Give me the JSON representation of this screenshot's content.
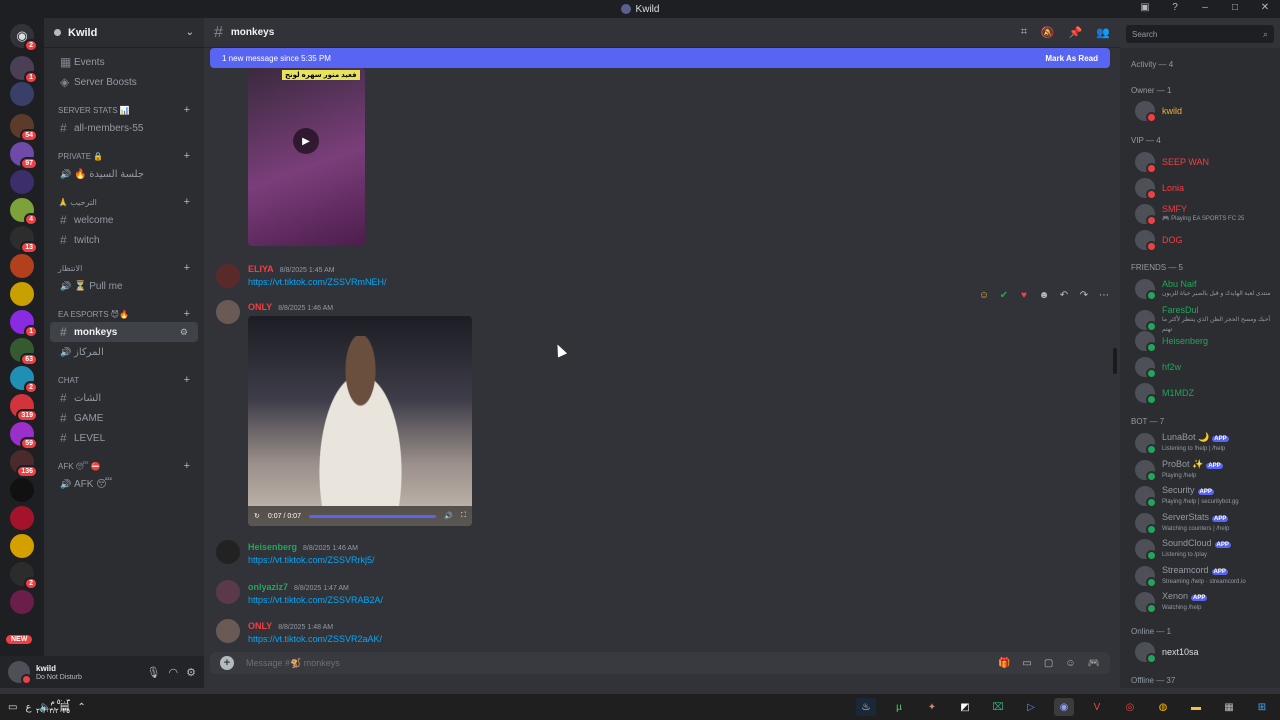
{
  "window": {
    "title": "Kwild"
  },
  "rail": {
    "servers": [
      {
        "badge": "2",
        "color": "#313338"
      },
      {
        "badge": "1",
        "color": "#4a3f55"
      },
      {
        "badge": "",
        "color": "#3a3f6a"
      },
      {
        "badge": "54",
        "color": "#5d3b2a"
      },
      {
        "badge": "97",
        "color": "#6f4aa8"
      },
      {
        "badge": "",
        "color": "#3b2e6a"
      },
      {
        "badge": "4",
        "color": "#7ca33a"
      },
      {
        "badge": "13",
        "color": "#2d2d2d"
      },
      {
        "badge": "",
        "color": "#b3401c"
      },
      {
        "badge": "",
        "color": "#c8a000"
      },
      {
        "badge": "1",
        "color": "#8a2be2"
      },
      {
        "badge": "63",
        "color": "#365a2f"
      },
      {
        "badge": "2",
        "color": "#1f8fb3"
      },
      {
        "badge": "319",
        "color": "#d1343c"
      },
      {
        "badge": "59",
        "color": "#9a2fc9"
      },
      {
        "badge": "136",
        "color": "#4a2a2a"
      },
      {
        "badge": "",
        "color": "#111111"
      },
      {
        "badge": "",
        "color": "#a3142a"
      },
      {
        "badge": "",
        "color": "#d4a000"
      },
      {
        "badge": "2",
        "color": "#2c2c2c"
      },
      {
        "badge": "",
        "color": "#6a1e4a"
      }
    ],
    "new_label": "NEW"
  },
  "sidebar": {
    "server_name": "Kwild",
    "top_items": [
      "Events",
      "Server Boosts"
    ],
    "categories": [
      {
        "name": "SERVER STATS 📊",
        "channels": [
          {
            "name": "all-members-55",
            "type": "text"
          }
        ]
      },
      {
        "name": "Private 🔒",
        "channels": [
          {
            "name": "🔥 جلسة السيدة",
            "type": "voice"
          }
        ]
      },
      {
        "name": "🙏 الترحيب",
        "channels": [
          {
            "name": "welcome",
            "type": "text"
          },
          {
            "name": "twitch",
            "type": "text"
          }
        ]
      },
      {
        "name": "الانتظار",
        "channels": [
          {
            "name": "⏳ Pull me",
            "type": "voice"
          }
        ]
      },
      {
        "name": "EA ESPORTS 😈🔥",
        "channels": [
          {
            "name": "monkeys",
            "type": "text",
            "active": true
          },
          {
            "name": "المركاز",
            "type": "voice"
          }
        ]
      },
      {
        "name": "CHAT",
        "channels": [
          {
            "name": "الشات",
            "type": "text"
          },
          {
            "name": "GAME",
            "type": "text"
          },
          {
            "name": "LEVEL",
            "type": "text"
          }
        ]
      },
      {
        "name": "AFK 😴 ⛔",
        "channels": [
          {
            "name": "AFK 😴",
            "type": "voice"
          }
        ]
      }
    ]
  },
  "user": {
    "name": "kwild",
    "status": "Do Not Disturb"
  },
  "channel": {
    "name": "monkeys"
  },
  "search": {
    "placeholder": "Search"
  },
  "newbar": {
    "text": "1 new message since 5:35 PM",
    "mark_label": "Mark As Read"
  },
  "messages": [
    {
      "name": "ELIYA",
      "name_color": "#f23f43",
      "time": "8/8/2025 1:45 AM",
      "link": "https://vt.tiktok.com/ZSSVRmNEH/"
    },
    {
      "name": "ONLY",
      "name_color": "#f23f43",
      "time": "8/8/2025 1:46 AM",
      "video_time": "0:07 / 0:07"
    },
    {
      "name": "Heisenberg",
      "name_color": "#23a55a",
      "time": "8/8/2025 1:46 AM",
      "link": "https://vt.tiktok.com/ZSSVRrkj5/"
    },
    {
      "name": "onlyaziz7",
      "name_color": "#23a55a",
      "time": "8/8/2025 1:47 AM",
      "link": "https://vt.tiktok.com/ZSSVRAB2A/"
    },
    {
      "name": "ONLY",
      "name_color": "#f23f43",
      "time": "8/8/2025 1:48 AM",
      "link": "https://vt.tiktok.com/ZSSVR2aAK/"
    }
  ],
  "video1_caption": "فعيد منور سهره لونج",
  "composer": {
    "placeholder": "Message #🐒 monkeys"
  },
  "members": {
    "activity": "Activity — 4",
    "owner_header": "Owner — 1",
    "owner": [
      {
        "name": "kwild",
        "color": "#f0b232",
        "sub": ""
      }
    ],
    "vip_header": "VIP — 4",
    "vip": [
      {
        "name": "SEEP WAN",
        "color": "#f23f43",
        "sub": ""
      },
      {
        "name": "Lonia",
        "color": "#f23f43",
        "sub": ""
      },
      {
        "name": "SMFY",
        "color": "#f23f43",
        "sub": "🎮 Playing EA SPORTS FC 25"
      },
      {
        "name": "DOG",
        "color": "#f23f43",
        "sub": ""
      }
    ],
    "friends_header": "FRIENDS — 5",
    "friends": [
      {
        "name": "Abu Naif",
        "color": "#23a55a",
        "sub": "منتدى لعبة الهايدك و قبل بالصبر حياة للزبون"
      },
      {
        "name": "FaresDul",
        "color": "#23a55a",
        "sub": "أحبك ومسح الحجر الظن الذي ينتظر لأكثر ما تهتم"
      },
      {
        "name": "Heisenberg",
        "color": "#23a55a",
        "sub": ""
      },
      {
        "name": "hf2w",
        "color": "#23a55a",
        "sub": ""
      },
      {
        "name": "M1MDZ",
        "color": "#23a55a",
        "sub": ""
      }
    ],
    "bot_header": "BOT — 7",
    "bots": [
      {
        "name": "LunaBot 🌙",
        "color": "#949ba4",
        "sub": "Listening to !help | /help"
      },
      {
        "name": "ProBot ✨",
        "color": "#949ba4",
        "sub": "Playing /help"
      },
      {
        "name": "Security",
        "color": "#949ba4",
        "sub": "Playing /help | securitybot.gg"
      },
      {
        "name": "ServerStats",
        "color": "#949ba4",
        "sub": "Watching counters | /help"
      },
      {
        "name": "SoundCloud",
        "color": "#949ba4",
        "sub": "Listening to /play"
      },
      {
        "name": "Streamcord",
        "color": "#949ba4",
        "sub": "Streaming /help · streamcord.io"
      },
      {
        "name": "Xenon",
        "color": "#949ba4",
        "sub": "Watching /help"
      }
    ],
    "app_tag": "APP",
    "online_header": "Online — 1",
    "online": [
      {
        "name": "next10sa",
        "color": "#dbdee1",
        "sub": ""
      }
    ],
    "offline_header": "Offline — 37"
  },
  "taskbar": {
    "lang": "ع",
    "time": "٥:٠٣ م",
    "date": "٢٠/٠٣/٢٠٢٥"
  },
  "colors": {
    "accent": "#5865f2",
    "online": "#23a55a",
    "dnd": "#f23f43",
    "link": "#00a8fc"
  }
}
